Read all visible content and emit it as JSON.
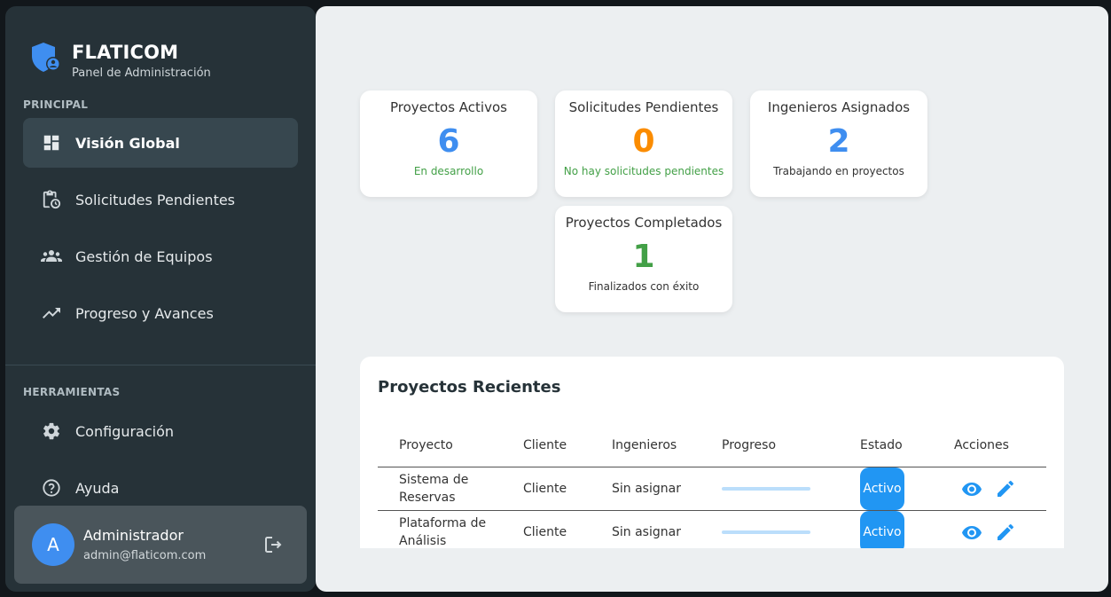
{
  "sidebar": {
    "brand_title": "FLATICOM",
    "brand_subtitle": "Panel de Administración",
    "section_principal": "PRINCIPAL",
    "section_tools": "HERRAMIENTAS",
    "nav": [
      {
        "label": "Visión Global",
        "icon": "dashboard-icon",
        "active": true
      },
      {
        "label": "Solicitudes Pendientes",
        "icon": "clipboard-clock-icon"
      },
      {
        "label": "Gestión de Equipos",
        "icon": "groups-icon"
      },
      {
        "label": "Progreso y Avances",
        "icon": "trending-up-icon"
      }
    ],
    "tools": [
      {
        "label": "Configuración",
        "icon": "gear-icon"
      },
      {
        "label": "Ayuda",
        "icon": "help-icon"
      }
    ],
    "user": {
      "initial": "A",
      "name": "Administrador",
      "email": "admin@flaticom.com"
    }
  },
  "stats": [
    {
      "title": "Proyectos Activos",
      "value": "6",
      "note": "En desarrollo",
      "color": "#3f8ef0",
      "note_color": "#43a047"
    },
    {
      "title": "Solicitudes Pendientes",
      "value": "0",
      "note": "No hay solicitudes pendientes",
      "color": "#fb8c00",
      "note_color": "#43a047"
    },
    {
      "title": "Ingenieros Asignados",
      "value": "2",
      "note": "Trabajando en proyectos",
      "color": "#3f8ef0",
      "note_color": "#333333"
    },
    {
      "title": "Proyectos Completados",
      "value": "1",
      "note": "Finalizados con éxito",
      "color": "#43a047",
      "note_color": "#333333"
    }
  ],
  "recent": {
    "title": "Proyectos Recientes",
    "headers": [
      "Proyecto",
      "Cliente",
      "Ingenieros",
      "Progreso",
      "Estado",
      "Acciones"
    ],
    "rows": [
      {
        "project": "Sistema de Reservas",
        "client": "Cliente",
        "engineers": "Sin asignar",
        "progress": 0,
        "status": "Activo"
      },
      {
        "project": "Plataforma de Análisis",
        "client": "Cliente",
        "engineers": "Sin asignar",
        "progress": 0,
        "status": "Activo"
      }
    ]
  }
}
